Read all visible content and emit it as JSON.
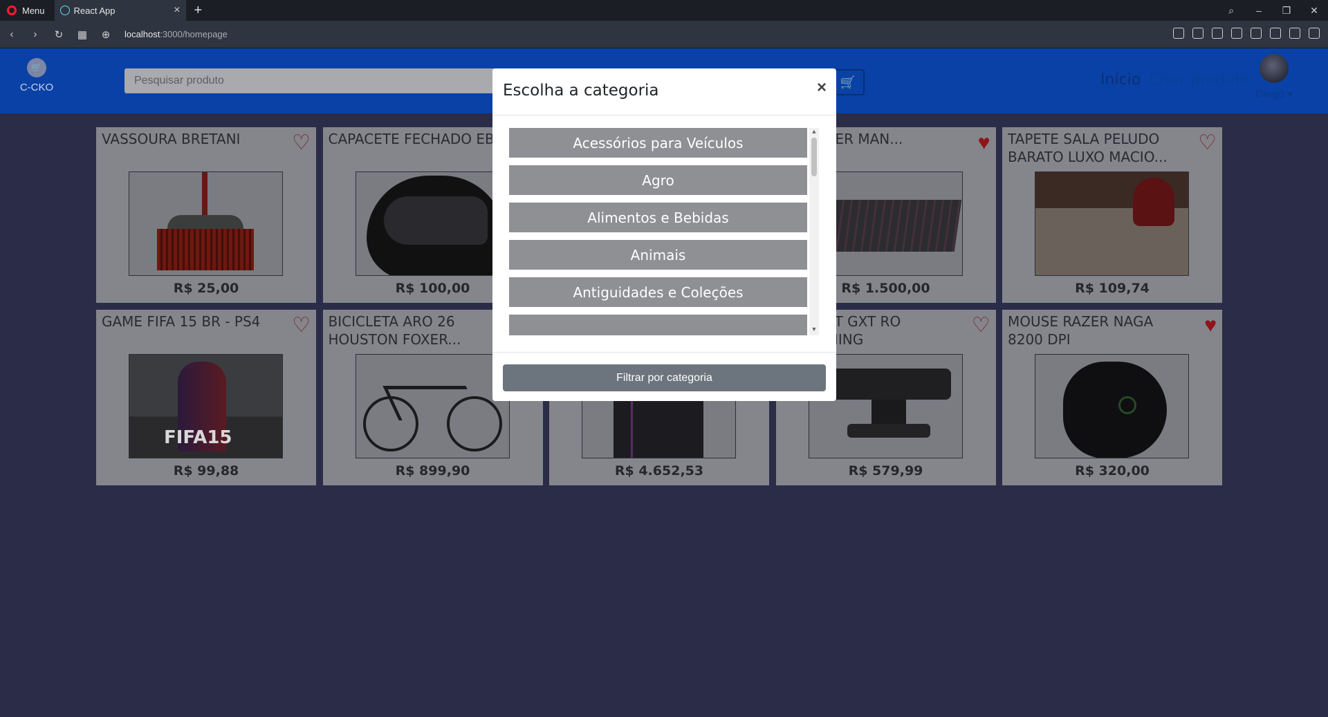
{
  "browser": {
    "menu_label": "Menu",
    "tab_title": "React App",
    "tab_close": "×",
    "new_tab": "+",
    "url_host": "localhost",
    "url_path": ":3000/homepage"
  },
  "header": {
    "brand": "C-CKO",
    "search_placeholder": "Pesquisar produto",
    "nav_inicio": "Início",
    "nav_criar": "Criar produto",
    "user_name": "Diego",
    "accent_color": "#0a41a6"
  },
  "products": [
    {
      "title": "VASSOURA BRETANI",
      "price": "R$ 25,00",
      "favorited": false,
      "icon": "broom"
    },
    {
      "title": "CAPACETE FECHADO EBF",
      "price": "R$ 100,00",
      "favorited": false,
      "icon": "helmet"
    },
    {
      "title": "",
      "price": "",
      "favorited": false,
      "icon": "hidden-by-modal"
    },
    {
      "title": "DO RAZER MAN...",
      "price": "R$ 1.500,00",
      "favorited": true,
      "icon": "keyboard"
    },
    {
      "title": "TAPETE SALA PELUDO BARATO LUXO MACIO...",
      "price": "R$ 109,74",
      "favorited": false,
      "icon": "rug"
    },
    {
      "title": "GAME FIFA 15 BR - PS4",
      "price": "R$ 99,88",
      "favorited": false,
      "icon": "game-cover"
    },
    {
      "title": "BICICLETA ARO 26 HOUSTON FOXER...",
      "price": "R$ 899,90",
      "favorited": false,
      "icon": "bicycle"
    },
    {
      "title": "",
      "price": "R$ 4.652,53",
      "favorited": false,
      "icon": "pc-case"
    },
    {
      "title": "M TRUST GXT RO STREAMING",
      "price": "R$ 579,99",
      "favorited": false,
      "icon": "webcam"
    },
    {
      "title": "MOUSE RAZER NAGA 8200 DPI",
      "price": "R$ 320,00",
      "favorited": true,
      "icon": "mouse"
    }
  ],
  "modal": {
    "title": "Escolha a categoria",
    "close": "×",
    "categories": [
      "Acessórios para Veículos",
      "Agro",
      "Alimentos e Bebidas",
      "Animais",
      "Antiguidades e Coleções",
      ""
    ],
    "filter_button": "Filtrar por categoria"
  }
}
